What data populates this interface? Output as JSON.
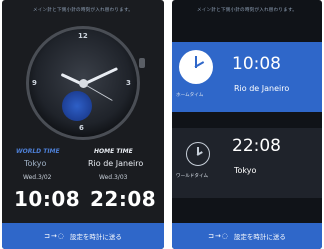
{
  "screen1": {
    "header_text": "メイン針と下側小針の時刻が入れ替わります。",
    "watch": {
      "bezel_numbers": [
        "12",
        "3",
        "9",
        "6"
      ]
    },
    "world_time": {
      "label": "WORLD TIME",
      "city": "Tokyo",
      "date": "Wed.3/02",
      "time": "10:08"
    },
    "home_time": {
      "label": "HOME TIME",
      "city": "Rio de Janeiro",
      "date": "Wed.3/03",
      "time": "22:08"
    },
    "send_button": {
      "icon": "⊐→◌",
      "label": "設定を時計に送る"
    }
  },
  "screen2": {
    "header_text": "メイン針と下側小針の時刻が入れ替わります。",
    "home": {
      "time": "10:08",
      "city": "Rio de Janeiro",
      "label": "ホームタイム"
    },
    "world": {
      "time": "22:08",
      "city": "Tokyo",
      "label": "ワールドタイム"
    },
    "send_button": {
      "icon": "⊐→◌",
      "label": "設定を時計に送る"
    }
  },
  "colors": {
    "accent": "#2f67c9",
    "background": "#1a1c20"
  }
}
